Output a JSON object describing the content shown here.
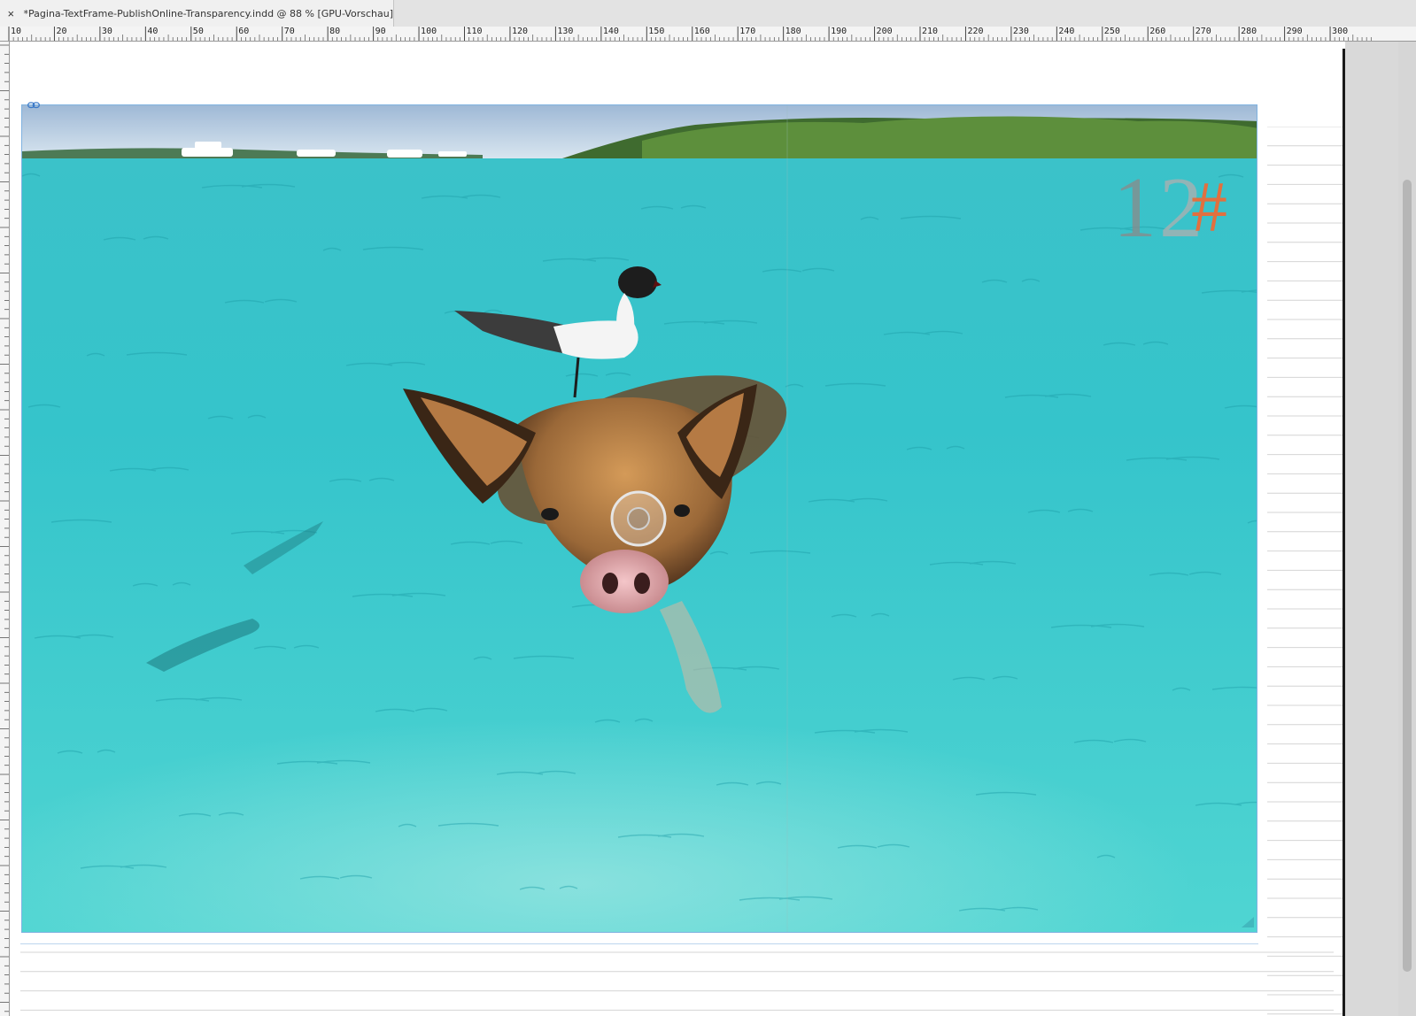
{
  "document_tab": {
    "close_glyph": "×",
    "title": "*Pagina-TextFrame-PublishOnline-Transparency.indd @ 88 % [GPU-Vorschau]"
  },
  "ruler": {
    "labels": [
      "10",
      "20",
      "30",
      "40",
      "50",
      "60",
      "70",
      "80",
      "90",
      "100",
      "110",
      "120",
      "130",
      "140",
      "150",
      "160",
      "170",
      "180",
      "190",
      "200",
      "210",
      "220",
      "230",
      "240",
      "250",
      "260",
      "270",
      "280",
      "290",
      "300"
    ]
  },
  "page_number": {
    "text": "12#",
    "colors": {
      "digit_1": "#8a8a8a",
      "digit_2": "#b0b0b0",
      "hash": "#e2703f"
    }
  },
  "colors": {
    "selection_frame": "#7fb2e0",
    "page_edge": "#1a1a1a",
    "pasteboard": "#d9d9d9"
  },
  "icons": {
    "tab_close": "close-icon",
    "linked_image": "chain-link-icon",
    "content_grabber": "donut-content-grabber-icon"
  }
}
